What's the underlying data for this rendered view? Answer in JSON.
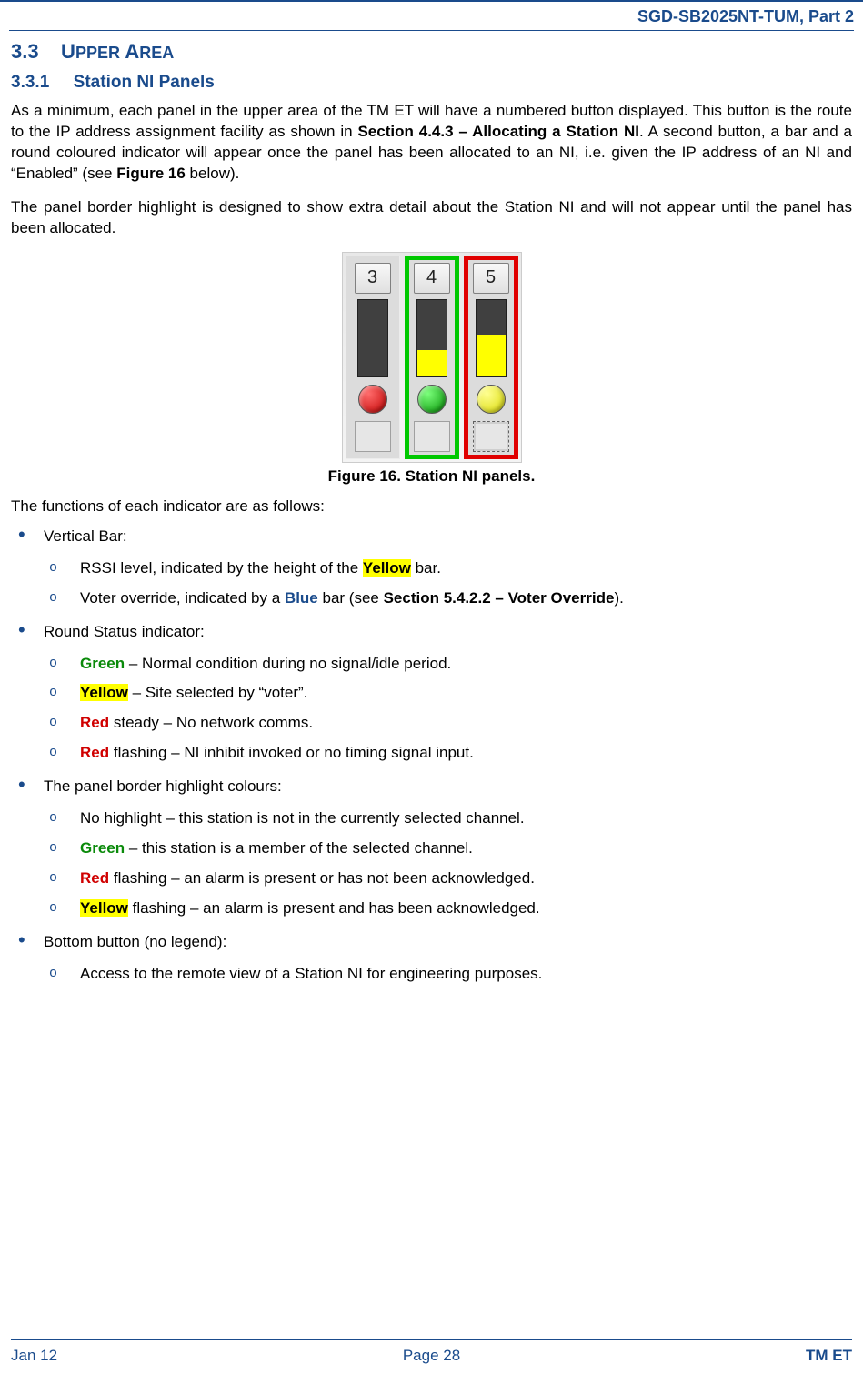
{
  "header": {
    "doc_id": "SGD-SB2025NT-TUM, Part 2"
  },
  "section": {
    "num": "3.3",
    "title": "UPPER AREA",
    "sub_num": "3.3.1",
    "sub_title": "Station NI Panels"
  },
  "paras": {
    "p1a": "As a minimum, each panel in the upper area of the TM ET will have a numbered button displayed. This button is the route to the IP address assignment facility as shown in ",
    "p1_ref1": "Section 4.4.3 – Allocating a Station NI",
    "p1b": ".  A second button, a bar and a round coloured indicator will appear once the panel has been allocated to an NI, i.e. given the IP address of an NI and “Enabled” (see ",
    "p1_ref2": "Figure 16",
    "p1c": " below).",
    "p2": "The panel border highlight is designed to show extra detail about the Station NI and will not appear until the panel has been allocated.",
    "p3": "The functions of each indicator are as follows:"
  },
  "figure": {
    "caption": "Figure 16.  Station NI panels.",
    "panels": [
      {
        "number": "3",
        "highlight": "none",
        "bar_pct": 0,
        "dot": "red"
      },
      {
        "number": "4",
        "highlight": "green",
        "bar_pct": 35,
        "dot": "green"
      },
      {
        "number": "5",
        "highlight": "red",
        "bar_pct": 55,
        "dot": "yellow"
      }
    ]
  },
  "bullets": {
    "b1": "Vertical Bar:",
    "b1_1a": "RSSI level, indicated by the height of the ",
    "b1_1_y": "Yellow",
    "b1_1b": " bar.",
    "b1_2a": "Voter override, indicated by a ",
    "b1_2_blue": "Blue",
    "b1_2b": " bar (see ",
    "b1_2_ref": "Section 5.4.2.2 – Voter Override",
    "b1_2c": ").",
    "b2": "Round Status indicator:",
    "b2_1_g": "Green",
    "b2_1t": " – Normal condition during no signal/idle period.",
    "b2_2_y": "Yellow",
    "b2_2t": " – Site selected by “voter”.",
    "b2_3_r": "Red",
    "b2_3t": " steady – No network comms.",
    "b2_4_r": "Red",
    "b2_4t": " flashing – NI inhibit invoked or no timing signal input.",
    "b3": "The panel border highlight colours:",
    "b3_1": "No highlight – this station is not in the currently selected channel.",
    "b3_2_g": "Green",
    "b3_2t": " – this station is a member of the selected channel.",
    "b3_3_r": "Red",
    "b3_3t": " flashing – an alarm is present or has not been acknowledged.",
    "b3_4_y": "Yellow",
    "b3_4t": " flashing – an alarm is present and has been acknowledged.",
    "b4": "Bottom button (no legend):",
    "b4_1": "Access to the remote view of a Station NI for engineering purposes."
  },
  "footer": {
    "left": "Jan 12",
    "center": "Page 28",
    "right": "TM ET"
  }
}
